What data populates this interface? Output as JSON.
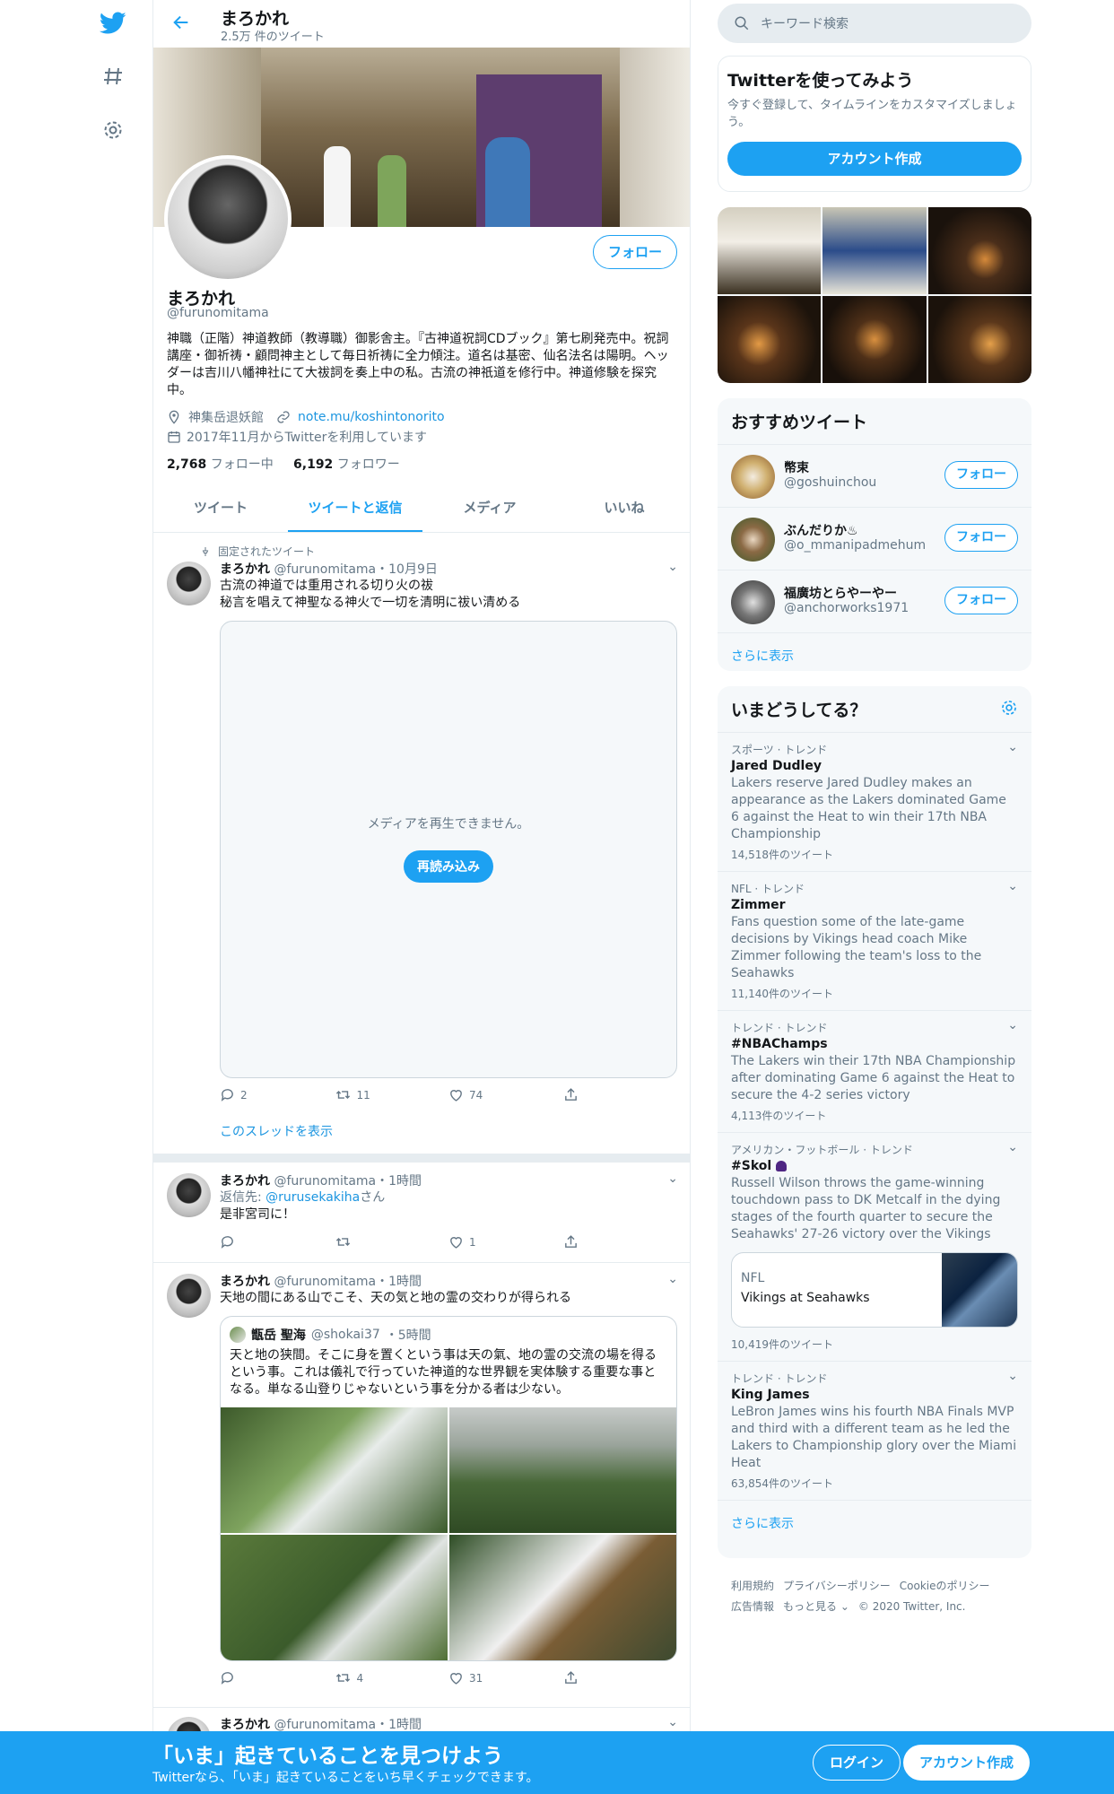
{
  "colors": {
    "accent": "#1da1f2",
    "muted": "#657786",
    "bottom_bar": "#1da1f2"
  },
  "nav": {
    "icons": [
      "twitter-logo-icon",
      "hashtag-icon",
      "gear-icon"
    ]
  },
  "header": {
    "name": "まろかれ",
    "tweet_count": "2.5万 件のツイート"
  },
  "profile": {
    "follow_label": "フォロー",
    "name": "まろかれ",
    "handle": "@furunomitama",
    "bio": "神職（正階）神道教師（教導職）御影舎主。『古神道祝詞CDブック』第七刷発売中。祝詞講座・御祈祷・顧問神主として毎日祈祷に全力傾注。道名は基密、仙名法名は陽明。ヘッダーは吉川八幡神社にて大祓詞を奏上中の私。古流の神祇道を修行中。神道修験を探究中。",
    "location": "神集岳退妖館",
    "link": "note.mu/koshintonorito",
    "joined": "2017年11月からTwitterを利用しています",
    "following_count": "2,768",
    "following_label": "フォロー中",
    "followers_count": "6,192",
    "followers_label": "フォロワー"
  },
  "tabs": [
    "ツイート",
    "ツイートと返信",
    "メディア",
    "いいね"
  ],
  "tweets": [
    {
      "pinned": "固定されたツイート",
      "name": "まろかれ",
      "handle": "@furunomitama",
      "time": "・10月9日",
      "line1": "古流の神道では重用される切り火の祓",
      "line2": "秘言を唱えて神聖なる神火で一切を清明に祓い清める",
      "media_msg": "メディアを再生できません。",
      "reload": "再読み込み",
      "replies": "2",
      "retweets": "11",
      "likes": "74",
      "thread": "このスレッドを表示"
    },
    {
      "name": "まろかれ",
      "handle": "@furunomitama",
      "time": "・1時間",
      "reply_prefix": "返信先: ",
      "reply_to": "@rurusekakiha",
      "reply_suffix": "さん",
      "text": "是非宮司に！",
      "replies": "",
      "retweets": "",
      "likes": "1"
    },
    {
      "name": "まろかれ",
      "handle": "@furunomitama",
      "time": "・1時間",
      "text": "天地の間にある山でこそ、天の気と地の霊の交わりが得られる",
      "quote": {
        "name": "甑岳 聖海",
        "handle": "@shokai37",
        "time": "・5時間",
        "text": "天と地の狭間。そこに身を置くという事は天の氣、地の霊の交流の場を得るという事。これは儀礼で行っていた神道的な世界観を実体験する重要な事となる。単なる山登りじゃないという事を分かる者は少ない。"
      },
      "replies": "",
      "retweets": "4",
      "likes": "31"
    },
    {
      "name": "まろかれ",
      "handle": "@furunomitama",
      "time": "・1時間"
    }
  ],
  "search": {
    "placeholder": "キーワード検索"
  },
  "signup_card": {
    "title": "Twitterを使ってみよう",
    "desc": "今すぐ登録して、タイムラインをカスタマイズしましょう。",
    "button": "アカウント作成"
  },
  "recommended": {
    "title": "おすすめツイート",
    "users": [
      {
        "name": "幣束",
        "handle": "@goshuinchou",
        "button": "フォロー"
      },
      {
        "name": "ぶんだりか♨",
        "handle": "@o_mmanipadmehum",
        "button": "フォロー"
      },
      {
        "name": "福廣坊とらやーやー",
        "handle": "@anchorworks1971",
        "button": "フォロー"
      }
    ],
    "more": "さらに表示"
  },
  "trends": {
    "title": "いまどうしてる？",
    "items": [
      {
        "category": "スポーツ · トレンド",
        "title": "Jared Dudley",
        "desc": "Lakers reserve Jared Dudley makes an appearance as the Lakers dominated Game 6 against the Heat to win their 17th NBA Championship",
        "count": "14,518件のツイート"
      },
      {
        "category": "NFL · トレンド",
        "title": "Zimmer",
        "desc": "Fans question some of the late-game decisions by Vikings head coach Mike Zimmer following the team's loss to the Seahawks",
        "count": "11,140件のツイート"
      },
      {
        "category": "トレンド · トレンド",
        "title": "#NBAChamps",
        "desc": "The Lakers win their 17th NBA Championship after dominating Game 6 against the Heat to secure the 4-2 series victory",
        "count": "4,113件のツイート"
      },
      {
        "category": "アメリカン・フットボール · トレンド",
        "title": "#Skol",
        "desc": "Russell Wilson throws the game-winning touchdown pass to DK Metcalf in the dying stages of the fourth quarter to secure the Seahawks' 27-26 victory over the Vikings",
        "card_category": "NFL",
        "card_title": "Vikings at Seahawks",
        "count": "10,419件のツイート"
      },
      {
        "category": "トレンド · トレンド",
        "title": "King James",
        "desc": "LeBron James wins his fourth NBA Finals MVP and third with a different team as he led the Lakers to Championship glory over the Miami Heat",
        "count": "63,854件のツイート"
      }
    ],
    "more": "さらに表示"
  },
  "footer": {
    "terms": "利用規約",
    "privacy": "プライバシーポリシー",
    "cookie": "Cookieのポリシー",
    "ads": "広告情報",
    "more": "もっと見る ⌄",
    "copyright": "© 2020 Twitter, Inc."
  },
  "bottom_bar": {
    "title": "「いま」起きていることを見つけよう",
    "subtitle": "Twitterなら、「いま」起きていることをいち早くチェックできます。",
    "login": "ログイン",
    "signup": "アカウント作成"
  }
}
